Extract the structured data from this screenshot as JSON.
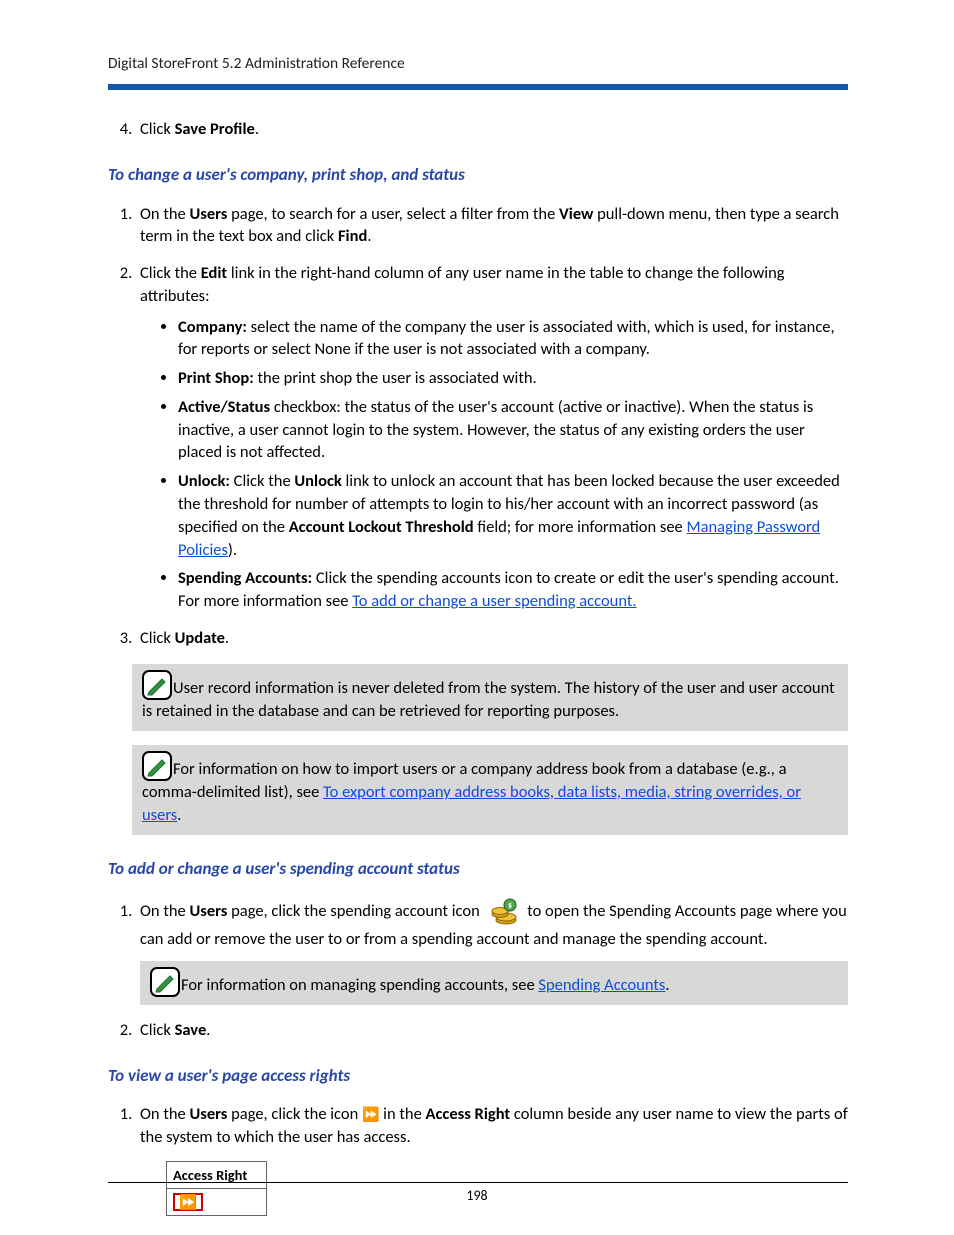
{
  "header": {
    "title": "Digital StoreFront 5.2 Administration Reference"
  },
  "step4": {
    "prefix": "Click ",
    "bold": "Save Profile",
    "suffix": "."
  },
  "heading1": "To change a user's company, print shop, and status",
  "list1": {
    "item1": {
      "p1": "On the ",
      "b1": "Users",
      "p2": " page, to search for a user, select a filter from the ",
      "b2": "View",
      "p3": " pull-down menu, then type a search term in the text box and click ",
      "b3": "Find",
      "p4": "."
    },
    "item2": {
      "p1": "Click the ",
      "b1": "Edit",
      "p2": " link in the right-hand column of any user name in the table to change the following attributes:"
    },
    "sub": {
      "a": {
        "b": "Company:",
        "t": " select the name of the company the user is associated with, which is used, for instance, for reports or select None if the user is not associated with a company."
      },
      "b": {
        "b": "Print Shop:",
        "t": " the print shop the user is associated with."
      },
      "c": {
        "b": "Active/Status",
        "t": " checkbox: the status of the user's account (active or inactive). When the status is inactive, a user cannot login to the system. However, the status of any existing orders the user placed is not affected."
      },
      "d": {
        "b1": "Unlock:",
        "t1": " Click the ",
        "b2": "Unlock",
        "t2": " link to unlock an account that has been locked because the user exceeded the threshold for number of attempts to login to his/her account with an incorrect password (as specified on the ",
        "b3": "Account Lockout Threshold",
        "t3": " field; for more information see ",
        "link": "Managing Password Policies",
        "t4": ")."
      },
      "e": {
        "b": "Spending Accounts:",
        "t1": " Click the spending accounts icon to create or edit the user's spending account. For more information see ",
        "link": "To add or change a user spending account.",
        "t2": ""
      }
    },
    "item3": {
      "p1": "Click ",
      "b1": "Update",
      "p2": "."
    }
  },
  "note1": "User record information is never deleted from the system. The history of the user and user account is retained in the database and can be retrieved for reporting purposes.",
  "note2": {
    "t1": "For information on how to import users or a company address book from a database (e.g., a comma-delimited list), see ",
    "link": "To export company address books, data lists, media, string overrides, or users",
    "t2": "."
  },
  "heading2": "To add or change a user's spending account status",
  "list2": {
    "item1": {
      "p1": "On the ",
      "b1": "Users",
      "p2": " page, click the spending account icon ",
      "p3": " to open the Spending Accounts page where you can add or remove the user to or from a spending account and manage the spending account."
    },
    "item2": {
      "p1": "Click ",
      "b1": "Save",
      "p2": "."
    }
  },
  "note3": {
    "t1": "For information on managing spending accounts, see ",
    "link": "Spending Accounts",
    "t2": "."
  },
  "heading3": "To view a user's page access rights",
  "list3": {
    "item1": {
      "p1": "On the ",
      "b1": "Users",
      "p2": " page, click the icon ",
      "p3": " in the ",
      "b2": "Access Right",
      "p4": " column beside any user name to view the parts of the system to which the user has access."
    }
  },
  "table": {
    "header": "Access Right"
  },
  "footer": {
    "page": "198"
  }
}
